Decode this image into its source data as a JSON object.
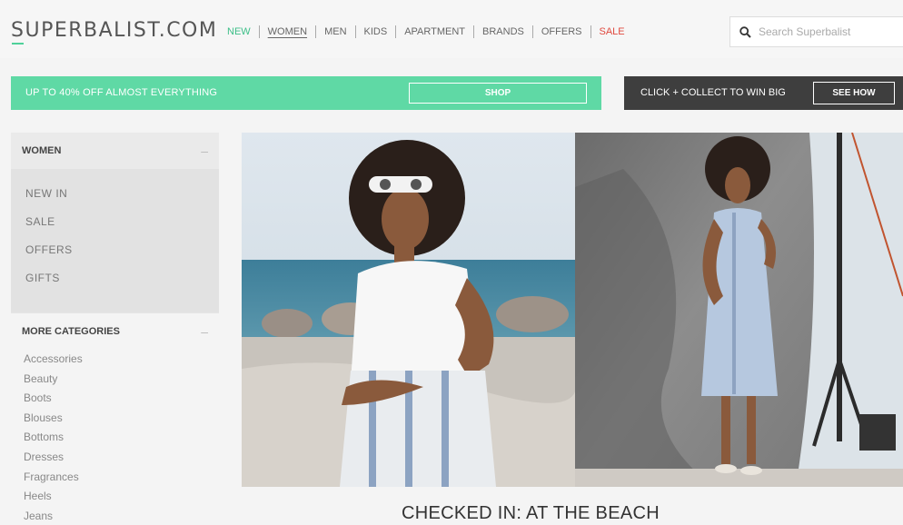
{
  "header": {
    "logo": "SUPERBALIST.COM",
    "nav": [
      {
        "label": "NEW"
      },
      {
        "label": "WOMEN"
      },
      {
        "label": "MEN"
      },
      {
        "label": "KIDS"
      },
      {
        "label": "APARTMENT"
      },
      {
        "label": "BRANDS"
      },
      {
        "label": "OFFERS"
      },
      {
        "label": "SALE"
      }
    ],
    "search_placeholder": "Search Superbalist"
  },
  "promo": {
    "green_text": "UP TO 40% OFF ALMOST EVERYTHING",
    "shop_label": "SHOP",
    "dark_text": "CLICK + COLLECT TO WIN BIG",
    "see_how_label": "SEE HOW"
  },
  "sidebar": {
    "heading": "WOMEN",
    "primary": [
      "NEW IN",
      "SALE",
      "OFFERS",
      "GIFTS"
    ],
    "more_heading": "MORE CATEGORIES",
    "categories": [
      "Accessories",
      "Beauty",
      "Boots",
      "Blouses",
      "Bottoms",
      "Dresses",
      "Fragrances",
      "Heels",
      "Jeans"
    ]
  },
  "hero": {
    "headline": "CHECKED IN: AT THE BEACH"
  },
  "colors": {
    "accent_green": "#5fd9a5",
    "sale_red": "#e04a3f",
    "dark_bar": "#3e3e3e"
  }
}
